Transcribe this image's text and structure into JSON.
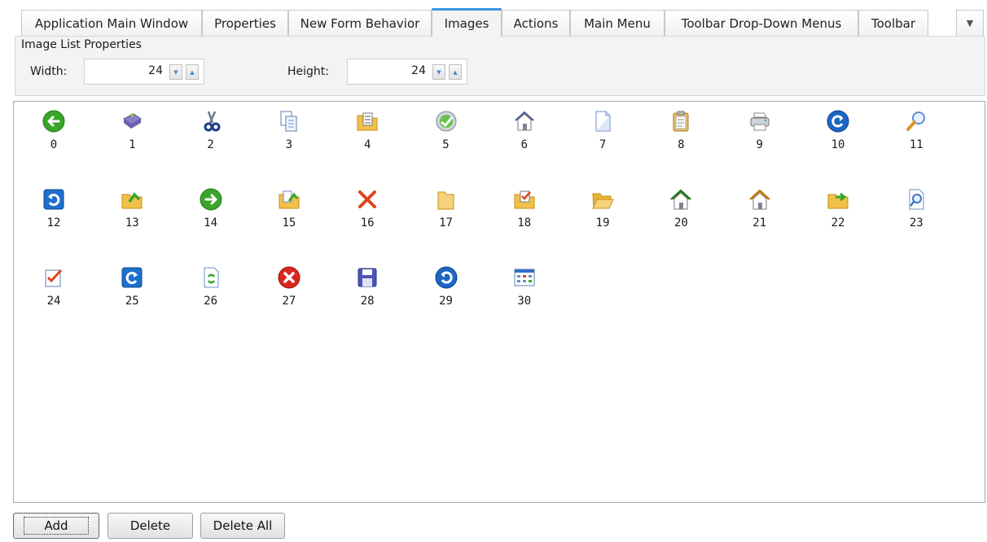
{
  "tabs": [
    {
      "label": "Application Main Window",
      "active": false
    },
    {
      "label": "Properties",
      "active": false
    },
    {
      "label": "New Form Behavior",
      "active": false
    },
    {
      "label": "Images",
      "active": true
    },
    {
      "label": "Actions",
      "active": false
    },
    {
      "label": "Main Menu",
      "active": false
    },
    {
      "label": "Toolbar Drop-Down Menus",
      "active": false
    },
    {
      "label": "Toolbar",
      "active": false
    }
  ],
  "tab_overflow_icon": "chevron-down-icon",
  "image_list_properties": {
    "title": "Image List Properties",
    "width_label": "Width:",
    "width_value": "24",
    "height_label": "Height:",
    "height_value": "24"
  },
  "images": [
    {
      "index": "0",
      "icon": "back-arrow-icon"
    },
    {
      "index": "1",
      "icon": "book-icon"
    },
    {
      "index": "2",
      "icon": "scissors-icon"
    },
    {
      "index": "3",
      "icon": "copy-icon"
    },
    {
      "index": "4",
      "icon": "folder-checklist-icon"
    },
    {
      "index": "5",
      "icon": "globe-refresh-icon"
    },
    {
      "index": "6",
      "icon": "home-icon"
    },
    {
      "index": "7",
      "icon": "blank-page-icon"
    },
    {
      "index": "8",
      "icon": "clipboard-icon"
    },
    {
      "index": "9",
      "icon": "printer-icon"
    },
    {
      "index": "10",
      "icon": "redo-circle-icon"
    },
    {
      "index": "11",
      "icon": "magnifier-icon"
    },
    {
      "index": "12",
      "icon": "undo-square-icon"
    },
    {
      "index": "13",
      "icon": "folder-up-icon"
    },
    {
      "index": "14",
      "icon": "forward-arrow-icon"
    },
    {
      "index": "15",
      "icon": "folder-copy-icon"
    },
    {
      "index": "16",
      "icon": "delete-x-icon"
    },
    {
      "index": "17",
      "icon": "folder-closed-icon"
    },
    {
      "index": "18",
      "icon": "folder-check-icon"
    },
    {
      "index": "19",
      "icon": "folder-open-icon"
    },
    {
      "index": "20",
      "icon": "home-green-icon"
    },
    {
      "index": "21",
      "icon": "home-orange-icon"
    },
    {
      "index": "22",
      "icon": "folder-arrow-icon"
    },
    {
      "index": "23",
      "icon": "page-search-icon"
    },
    {
      "index": "24",
      "icon": "checklist-icon"
    },
    {
      "index": "25",
      "icon": "redo-square-icon"
    },
    {
      "index": "26",
      "icon": "page-refresh-icon"
    },
    {
      "index": "27",
      "icon": "error-circle-icon"
    },
    {
      "index": "28",
      "icon": "save-disk-icon"
    },
    {
      "index": "29",
      "icon": "undo-circle-icon"
    },
    {
      "index": "30",
      "icon": "grid-table-icon"
    }
  ],
  "buttons": {
    "add": "Add",
    "delete": "Delete",
    "delete_all": "Delete All"
  },
  "colors": {
    "active_tab_accent": "#3d95e0",
    "panel_background": "#f3f3f3"
  }
}
